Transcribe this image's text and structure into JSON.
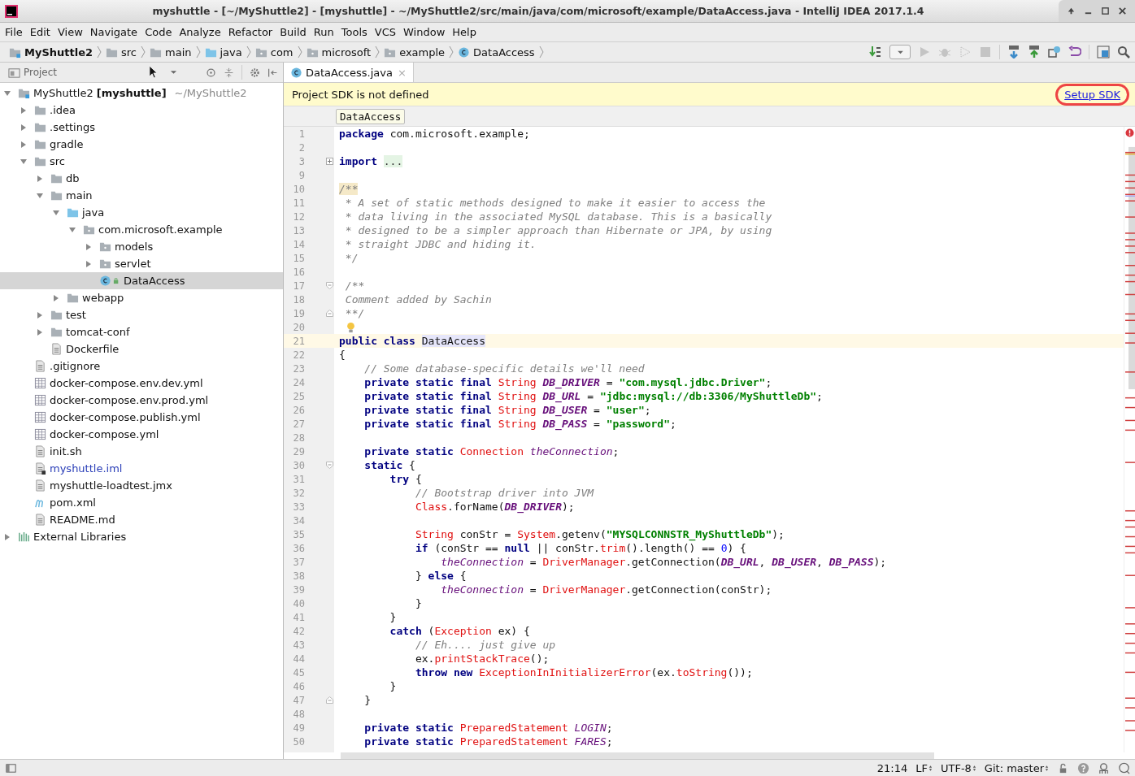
{
  "window": {
    "title": "myshuttle - [~/MyShuttle2] - [myshuttle] - ~/MyShuttle2/src/main/java/com/microsoft/example/DataAccess.java - IntelliJ IDEA 2017.1.4"
  },
  "menu": [
    "File",
    "Edit",
    "View",
    "Navigate",
    "Code",
    "Analyze",
    "Refactor",
    "Build",
    "Run",
    "Tools",
    "VCS",
    "Window",
    "Help"
  ],
  "nav_bar": [
    {
      "label": "MyShuttle2",
      "kind": "module"
    },
    {
      "label": "src",
      "kind": "folder"
    },
    {
      "label": "main",
      "kind": "folder"
    },
    {
      "label": "java",
      "kind": "source"
    },
    {
      "label": "com",
      "kind": "package"
    },
    {
      "label": "microsoft",
      "kind": "package"
    },
    {
      "label": "example",
      "kind": "package"
    },
    {
      "label": "DataAccess",
      "kind": "class"
    }
  ],
  "project_panel": {
    "title": "Project"
  },
  "tree": [
    {
      "label": "MyShuttle2",
      "tag": "[myshuttle]",
      "path": "~/MyShuttle2",
      "kind": "module",
      "expanded": true,
      "selected": false,
      "children": [
        {
          "label": ".idea",
          "kind": "folder",
          "expanded": false,
          "selected": false
        },
        {
          "label": ".settings",
          "kind": "folder",
          "expanded": false,
          "selected": false
        },
        {
          "label": "gradle",
          "kind": "folder",
          "expanded": false,
          "selected": false
        },
        {
          "label": "src",
          "kind": "folder",
          "expanded": true,
          "selected": false,
          "children": [
            {
              "label": "db",
              "kind": "folder",
              "expanded": false,
              "selected": false
            },
            {
              "label": "main",
              "kind": "folder",
              "expanded": true,
              "selected": false,
              "children": [
                {
                  "label": "java",
                  "kind": "source",
                  "expanded": true,
                  "selected": false,
                  "children": [
                    {
                      "label": "com.microsoft.example",
                      "kind": "package",
                      "expanded": true,
                      "selected": false,
                      "children": [
                        {
                          "label": "models",
                          "kind": "package",
                          "expanded": false,
                          "selected": false
                        },
                        {
                          "label": "servlet",
                          "kind": "package",
                          "expanded": false,
                          "selected": false
                        },
                        {
                          "label": "DataAccess",
                          "kind": "class",
                          "selected": true
                        }
                      ]
                    }
                  ]
                },
                {
                  "label": "webapp",
                  "kind": "folder",
                  "expanded": false,
                  "selected": false
                }
              ]
            },
            {
              "label": "test",
              "kind": "folder",
              "expanded": false,
              "selected": false
            },
            {
              "label": "tomcat-conf",
              "kind": "folder",
              "expanded": false,
              "selected": false
            },
            {
              "label": "Dockerfile",
              "kind": "file",
              "selected": false
            }
          ]
        },
        {
          "label": ".gitignore",
          "kind": "file",
          "selected": false
        },
        {
          "label": "docker-compose.env.dev.yml",
          "kind": "yml",
          "selected": false
        },
        {
          "label": "docker-compose.env.prod.yml",
          "kind": "yml",
          "selected": false
        },
        {
          "label": "docker-compose.publish.yml",
          "kind": "yml",
          "selected": false
        },
        {
          "label": "docker-compose.yml",
          "kind": "yml",
          "selected": false
        },
        {
          "label": "init.sh",
          "kind": "file",
          "selected": false
        },
        {
          "label": "myshuttle.iml",
          "kind": "iml",
          "selected": false
        },
        {
          "label": "myshuttle-loadtest.jmx",
          "kind": "file",
          "selected": false
        },
        {
          "label": "pom.xml",
          "kind": "maven",
          "selected": false
        },
        {
          "label": "README.md",
          "kind": "file",
          "selected": false
        }
      ]
    },
    {
      "label": "External Libraries",
      "kind": "libraries",
      "expanded": false,
      "selected": false
    }
  ],
  "editor_tabs": [
    {
      "label": "DataAccess.java",
      "close": "×",
      "selected": true
    }
  ],
  "notification": {
    "text": "Project SDK is not defined",
    "link": "Setup SDK",
    "circled": true
  },
  "breadcrumb": "DataAccess",
  "lines": [
    {
      "n": "1",
      "tokens": [
        {
          "kind": "keyword",
          "text": "package "
        },
        {
          "kind": "plain",
          "text": "com.microsoft.example;"
        }
      ]
    },
    {
      "n": "2"
    },
    {
      "n": "3",
      "folded": true,
      "tokens": [
        {
          "kind": "keyword",
          "text": "import "
        },
        {
          "kind": "collapsed",
          "text": "..."
        }
      ]
    },
    {
      "n": "9"
    },
    {
      "n": "10",
      "tokens": [
        {
          "kind": "doc",
          "text": "/**"
        }
      ]
    },
    {
      "n": "11",
      "tokens": [
        {
          "kind": "comment",
          "text": " * A set of static methods designed to make it easier to access the"
        }
      ]
    },
    {
      "n": "12",
      "tokens": [
        {
          "kind": "comment",
          "text": " * data living in the associated MySQL database. This is a basically"
        }
      ]
    },
    {
      "n": "13",
      "tokens": [
        {
          "kind": "comment",
          "text": " * designed to be a simpler approach than Hibernate or JPA, by using"
        }
      ]
    },
    {
      "n": "14",
      "tokens": [
        {
          "kind": "comment",
          "text": " * straight JDBC and hiding it."
        }
      ]
    },
    {
      "n": "15",
      "tokens": [
        {
          "kind": "comment",
          "text": " */"
        }
      ]
    },
    {
      "n": "16"
    },
    {
      "n": "17",
      "fold_start": true,
      "tokens": [
        {
          "kind": "comment",
          "text": " /**"
        }
      ]
    },
    {
      "n": "18",
      "tokens": [
        {
          "kind": "comment",
          "text": " Comment added by Sachin"
        }
      ]
    },
    {
      "n": "19",
      "fold_end": true,
      "tokens": [
        {
          "kind": "comment",
          "text": " **/"
        }
      ]
    },
    {
      "n": "20",
      "bulb": true
    },
    {
      "n": "21",
      "current": true,
      "tokens": [
        {
          "kind": "keyword",
          "text": "public class "
        },
        {
          "kind": "classref",
          "text": "DataAccess"
        }
      ]
    },
    {
      "n": "22",
      "tokens": [
        {
          "kind": "plain",
          "text": "{"
        }
      ]
    },
    {
      "n": "23",
      "tokens": [
        {
          "kind": "comment",
          "text": "    // Some database-specific details we'll need"
        }
      ]
    },
    {
      "n": "24",
      "tokens": [
        {
          "kind": "keyword",
          "text": "    private static final "
        },
        {
          "kind": "type",
          "text": "String "
        },
        {
          "kind": "constant",
          "text": "DB_DRIVER"
        },
        {
          "kind": "plain",
          "text": " = "
        },
        {
          "kind": "string",
          "text": "\"com.mysql.jdbc.Driver\""
        },
        {
          "kind": "plain",
          "text": ";"
        }
      ]
    },
    {
      "n": "25",
      "tokens": [
        {
          "kind": "keyword",
          "text": "    private static final "
        },
        {
          "kind": "type",
          "text": "String "
        },
        {
          "kind": "constant",
          "text": "DB_URL"
        },
        {
          "kind": "plain",
          "text": " = "
        },
        {
          "kind": "string",
          "text": "\"jdbc:mysql://db:3306/MyShuttleDb\""
        },
        {
          "kind": "plain",
          "text": ";"
        }
      ]
    },
    {
      "n": "26",
      "tokens": [
        {
          "kind": "keyword",
          "text": "    private static final "
        },
        {
          "kind": "type",
          "text": "String "
        },
        {
          "kind": "constant",
          "text": "DB_USER"
        },
        {
          "kind": "plain",
          "text": " = "
        },
        {
          "kind": "string",
          "text": "\"user\""
        },
        {
          "kind": "plain",
          "text": ";"
        }
      ]
    },
    {
      "n": "27",
      "tokens": [
        {
          "kind": "keyword",
          "text": "    private static final "
        },
        {
          "kind": "type",
          "text": "String "
        },
        {
          "kind": "constant",
          "text": "DB_PASS"
        },
        {
          "kind": "plain",
          "text": " = "
        },
        {
          "kind": "string",
          "text": "\"password\""
        },
        {
          "kind": "plain",
          "text": ";"
        }
      ]
    },
    {
      "n": "28"
    },
    {
      "n": "29",
      "tokens": [
        {
          "kind": "keyword",
          "text": "    private static "
        },
        {
          "kind": "type",
          "text": "Connection "
        },
        {
          "kind": "field",
          "text": "theConnection"
        },
        {
          "kind": "plain",
          "text": ";"
        }
      ]
    },
    {
      "n": "30",
      "fold_start": true,
      "tokens": [
        {
          "kind": "keyword",
          "text": "    static "
        },
        {
          "kind": "plain",
          "text": "{"
        }
      ]
    },
    {
      "n": "31",
      "tokens": [
        {
          "kind": "keyword",
          "text": "        try "
        },
        {
          "kind": "plain",
          "text": "{"
        }
      ]
    },
    {
      "n": "32",
      "tokens": [
        {
          "kind": "comment",
          "text": "            // Bootstrap driver into JVM"
        }
      ]
    },
    {
      "n": "33",
      "tokens": [
        {
          "kind": "type",
          "text": "            Class"
        },
        {
          "kind": "plain",
          "text": ".forName("
        },
        {
          "kind": "constant",
          "text": "DB_DRIVER"
        },
        {
          "kind": "plain",
          "text": ");"
        }
      ]
    },
    {
      "n": "34"
    },
    {
      "n": "35",
      "tokens": [
        {
          "kind": "type",
          "text": "            String "
        },
        {
          "kind": "plain",
          "text": "conStr = "
        },
        {
          "kind": "type",
          "text": "System"
        },
        {
          "kind": "plain",
          "text": ".getenv("
        },
        {
          "kind": "string",
          "text": "\"MYSQLCONNSTR_MyShuttleDb\""
        },
        {
          "kind": "plain",
          "text": ");"
        }
      ]
    },
    {
      "n": "36",
      "tokens": [
        {
          "kind": "keyword",
          "text": "            if "
        },
        {
          "kind": "plain",
          "text": "(conStr == "
        },
        {
          "kind": "keyword",
          "text": "null "
        },
        {
          "kind": "plain",
          "text": "|| conStr."
        },
        {
          "kind": "method",
          "text": "trim"
        },
        {
          "kind": "plain",
          "text": "().length() == "
        },
        {
          "kind": "number",
          "text": "0"
        },
        {
          "kind": "plain",
          "text": ") {"
        }
      ]
    },
    {
      "n": "37",
      "tokens": [
        {
          "kind": "field",
          "text": "                theConnection"
        },
        {
          "kind": "plain",
          "text": " = "
        },
        {
          "kind": "type",
          "text": "DriverManager"
        },
        {
          "kind": "plain",
          "text": ".getConnection("
        },
        {
          "kind": "constant",
          "text": "DB_URL"
        },
        {
          "kind": "plain",
          "text": ", "
        },
        {
          "kind": "constant",
          "text": "DB_USER"
        },
        {
          "kind": "plain",
          "text": ", "
        },
        {
          "kind": "constant",
          "text": "DB_PASS"
        },
        {
          "kind": "plain",
          "text": ");"
        }
      ]
    },
    {
      "n": "38",
      "tokens": [
        {
          "kind": "plain",
          "text": "            } "
        },
        {
          "kind": "keyword",
          "text": "else "
        },
        {
          "kind": "plain",
          "text": "{"
        }
      ]
    },
    {
      "n": "39",
      "tokens": [
        {
          "kind": "field",
          "text": "                theConnection"
        },
        {
          "kind": "plain",
          "text": " = "
        },
        {
          "kind": "type",
          "text": "DriverManager"
        },
        {
          "kind": "plain",
          "text": ".getConnection(conStr);"
        }
      ]
    },
    {
      "n": "40",
      "tokens": [
        {
          "kind": "plain",
          "text": "            }"
        }
      ]
    },
    {
      "n": "41",
      "tokens": [
        {
          "kind": "plain",
          "text": "        }"
        }
      ]
    },
    {
      "n": "42",
      "tokens": [
        {
          "kind": "keyword",
          "text": "        catch "
        },
        {
          "kind": "plain",
          "text": "("
        },
        {
          "kind": "type",
          "text": "Exception "
        },
        {
          "kind": "plain",
          "text": "ex) {"
        }
      ]
    },
    {
      "n": "43",
      "tokens": [
        {
          "kind": "comment",
          "text": "            // Eh.... just give up"
        }
      ]
    },
    {
      "n": "44",
      "tokens": [
        {
          "kind": "plain",
          "text": "            ex."
        },
        {
          "kind": "method",
          "text": "printStackTrace"
        },
        {
          "kind": "plain",
          "text": "();"
        }
      ]
    },
    {
      "n": "45",
      "tokens": [
        {
          "kind": "keyword",
          "text": "            throw new "
        },
        {
          "kind": "type",
          "text": "ExceptionInInitializerError"
        },
        {
          "kind": "plain",
          "text": "(ex."
        },
        {
          "kind": "method",
          "text": "toString"
        },
        {
          "kind": "plain",
          "text": "());"
        }
      ]
    },
    {
      "n": "46",
      "tokens": [
        {
          "kind": "plain",
          "text": "        }"
        }
      ]
    },
    {
      "n": "47",
      "fold_end": true,
      "tokens": [
        {
          "kind": "plain",
          "text": "    }"
        }
      ]
    },
    {
      "n": "48"
    },
    {
      "n": "49",
      "tokens": [
        {
          "kind": "keyword",
          "text": "    private static "
        },
        {
          "kind": "type",
          "text": "PreparedStatement "
        },
        {
          "kind": "field",
          "text": "LOGIN"
        },
        {
          "kind": "plain",
          "text": ";"
        }
      ]
    },
    {
      "n": "50",
      "tokens": [
        {
          "kind": "keyword",
          "text": "    private static "
        },
        {
          "kind": "type",
          "text": "PreparedStatement "
        },
        {
          "kind": "field",
          "text": "FARES"
        },
        {
          "kind": "plain",
          "text": ";"
        }
      ]
    }
  ],
  "status_bar": {
    "position": "21:14",
    "line_separator": "LF",
    "encoding": "UTF-8",
    "vcs": "Git: master"
  }
}
